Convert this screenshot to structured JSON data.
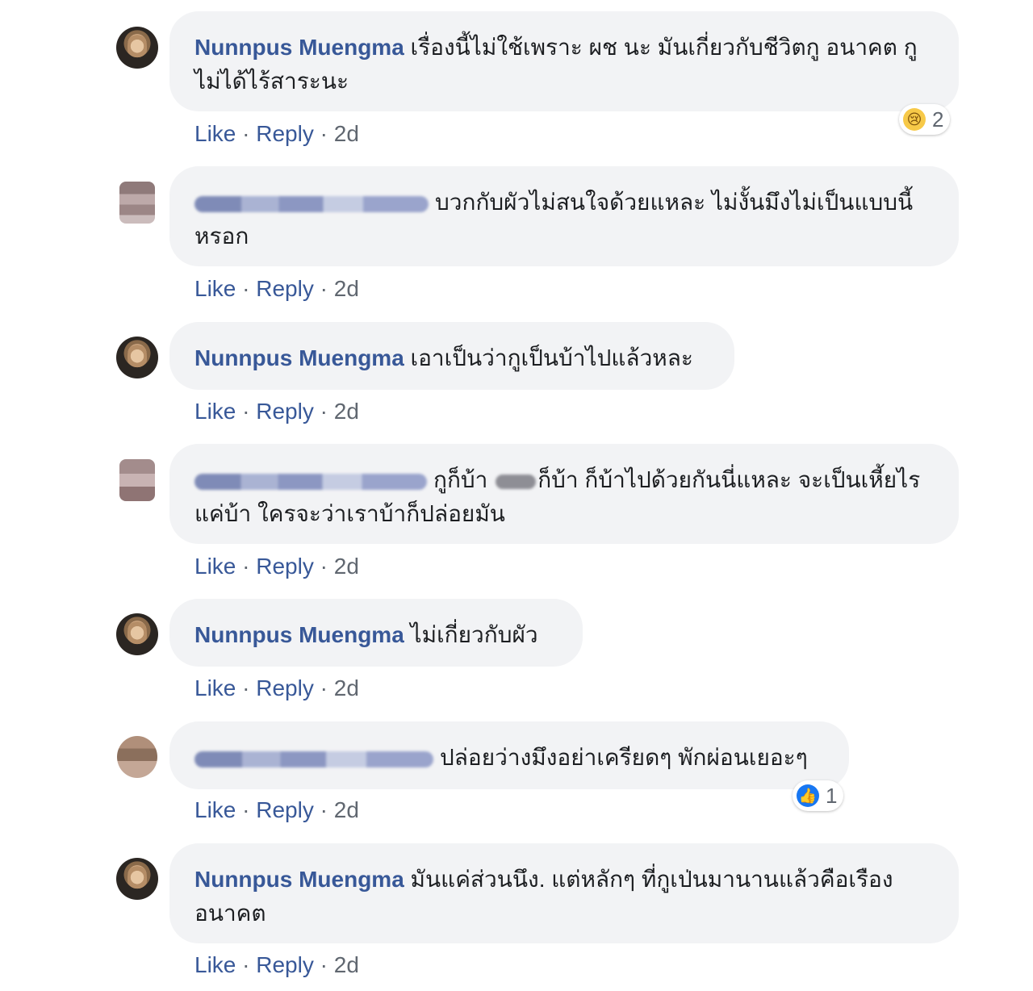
{
  "action_labels": {
    "like": "Like",
    "sep": " · ",
    "reply": "Reply"
  },
  "comments": [
    {
      "author": "Nunnpus Muengma",
      "text": "เรื่องนี้ไม่ใช้เพราะ ผช นะ มันเกี่ยวกับชีวิตกู อนาคต กูไม่ได้ไร้สาระนะ",
      "time": "2d",
      "reaction": {
        "icon": "sad-icon",
        "count": "2"
      }
    },
    {
      "author": "",
      "text": "บวกกับผัวไม่สนใจด้วยแหละ ไม่งั้นมึงไม่เป็นแบบนี้หรอก",
      "time": "2d"
    },
    {
      "author": "Nunnpus Muengma",
      "text": "เอาเป็นว่ากูเป็นบ้าไปแล้วหละ",
      "time": "2d"
    },
    {
      "author": "",
      "text_a": "กูก็บ้า ",
      "text_b": "ก็บ้า ก็บ้าไปด้วยกันนี่แหละ จะเป็นเหี้ยไร แค่บ้า ใครจะว่าเราบ้าก็ปล่อยมัน",
      "time": "2d"
    },
    {
      "author": "Nunnpus Muengma",
      "text": "ไม่เกี่ยวกับผัว",
      "time": "2d"
    },
    {
      "author": "",
      "text": "ปล่อยว่างมึงอย่าเครียดๆ พักผ่อนเยอะๆ",
      "time": "2d",
      "reaction": {
        "icon": "like-icon",
        "count": "1"
      }
    },
    {
      "author": "Nunnpus Muengma",
      "text": "มันแค่ส่วนนึง. แต่หลักๆ ที่กูเป่นมานานแล้วคือเรือง อนาคต",
      "time": "2d"
    }
  ],
  "colors": {
    "author": "#385898",
    "bubble": "#f2f3f5",
    "meta": "#606770",
    "text": "#1c1e21"
  }
}
